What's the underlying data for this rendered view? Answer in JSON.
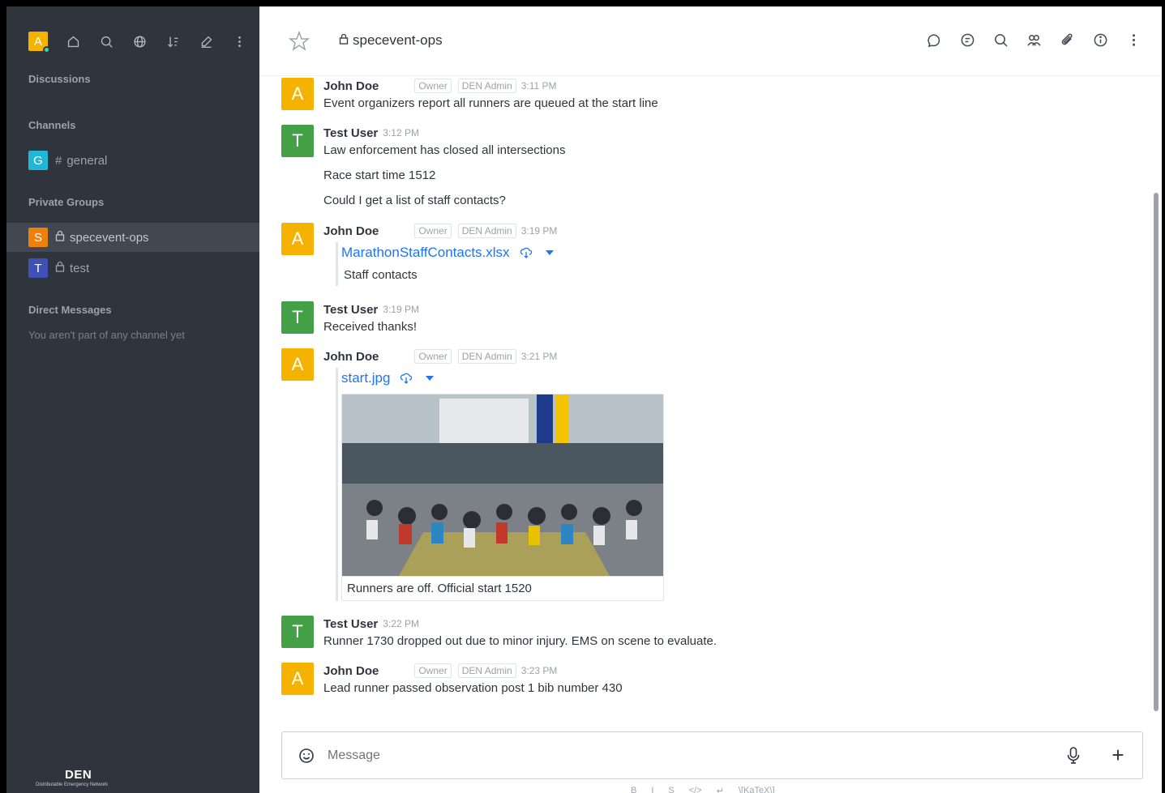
{
  "sidebar": {
    "user_initial": "A",
    "sections": {
      "discussions": "Discussions",
      "channels": "Channels",
      "private_groups": "Private Groups",
      "direct_messages": "Direct Messages"
    },
    "channels": [
      {
        "initial": "G",
        "name": "general",
        "color": "#1eb7d6"
      }
    ],
    "groups": [
      {
        "initial": "S",
        "name": "specevent-ops",
        "color": "#f0800c",
        "active": true
      },
      {
        "initial": "T",
        "name": "test",
        "color": "#3f51b5",
        "active": false
      }
    ],
    "dm_empty": "You aren't part of any channel yet",
    "logo_title": "DEN",
    "logo_subtitle": "Distributable Emergency Network"
  },
  "header": {
    "room_name": "specevent-ops"
  },
  "messages": [
    {
      "user": "John Doe",
      "initial": "A",
      "color": "#f5b300",
      "roles": [
        "Owner",
        "DEN Admin"
      ],
      "time": "3:11 PM",
      "lines": [
        "Event organizers report all runners are queued at the start line"
      ]
    },
    {
      "user": "Test User",
      "initial": "T",
      "color": "#43a047",
      "roles": [],
      "time": "3:12 PM",
      "lines": [
        "Law enforcement has closed all intersections",
        "Race start time 1512",
        "Could I get a list of staff contacts?"
      ]
    },
    {
      "user": "John Doe",
      "initial": "A",
      "color": "#f5b300",
      "roles": [
        "Owner",
        "DEN Admin"
      ],
      "time": "3:19 PM",
      "attachment": {
        "title": "MarathonStaffContacts.xlsx",
        "description": "Staff contacts"
      }
    },
    {
      "user": "Test User",
      "initial": "T",
      "color": "#43a047",
      "roles": [],
      "time": "3:19 PM",
      "lines": [
        "Received thanks!"
      ]
    },
    {
      "user": "John Doe",
      "initial": "A",
      "color": "#f5b300",
      "roles": [
        "Owner",
        "DEN Admin"
      ],
      "time": "3:21 PM",
      "attachment": {
        "title": "start.jpg",
        "caption": "Runners are off. Official start 1520"
      }
    },
    {
      "user": "Test User",
      "initial": "T",
      "color": "#43a047",
      "roles": [],
      "time": "3:22 PM",
      "lines": [
        "Runner 1730 dropped out due to minor injury. EMS on scene to evaluate."
      ]
    },
    {
      "user": "John Doe",
      "initial": "A",
      "color": "#f5b300",
      "roles": [
        "Owner",
        "DEN Admin"
      ],
      "time": "3:23 PM",
      "lines": [
        "Lead runner passed observation post 1 bib number 430"
      ]
    }
  ],
  "composer": {
    "placeholder": "Message",
    "format_items": [
      "B",
      "I",
      "S",
      "</>",
      "↵",
      "\\[KaTeX\\]"
    ]
  }
}
